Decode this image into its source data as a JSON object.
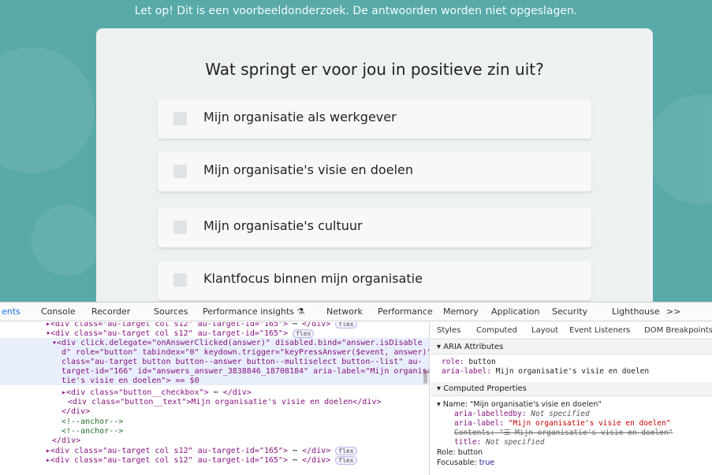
{
  "survey": {
    "banner": "Let op! Dit is een voorbeeldonderzoek. De antwoorden worden niet opgeslagen.",
    "question": "Wat springt er voor jou in positieve zin uit?",
    "answers": [
      "Mijn organisatie als werkgever",
      "Mijn organisatie's visie en doelen",
      "Mijn organisatie's cultuur",
      "Klantfocus binnen mijn organisatie"
    ]
  },
  "devtools": {
    "tabs": [
      "ents",
      "Console",
      "Recorder",
      "Sources",
      "Performance insights ⚗",
      "Network",
      "Performance",
      "Memory",
      "Application",
      "Security",
      "Lighthouse",
      ">>"
    ],
    "active_tab": "ents",
    "elements": {
      "line1_open": "▸<div class=\"au-target col s12\" au-target-id=\"165\">",
      "line1_close": "</div>",
      "line2": "▾<div class=\"au-target col s12\" au-target-id=\"165\">",
      "line3": "▾<div click.delegate=\"onAnswerClicked(answer)\" disabled.bind=\"answer.isDisable",
      "line4": "d\" role=\"button\" tabindex=\"0\" keydown.trigger=\"keyPressAnswer($event, answer)\"",
      "line5": "class=\"au-target button button--answer button--multiselect button--list\" au-",
      "line6": "target-id=\"166\" id=\"answers_answer_3838846_18708184\" aria-label=\"Mijn organisa",
      "line7": "tie's visie en doelen\"> == $0",
      "line8": "▸<div class=\"button__checkbox\"> ",
      "line8_close": "</div>",
      "line9": "<div class=\"button__text\">Mijn organisatie's visie en doelen</div>",
      "line10": "</div>",
      "line11": "<!--anchor-->",
      "line12": "<!--anchor-->",
      "line13": "</div>",
      "line14": "▸<div class=\"au-target col s12\" au-target-id=\"165\">",
      "line15": "▸<div class=\"au-target col s12\" au-target-id=\"165\">",
      "badge": "flex",
      "ellipsis": "⋯"
    },
    "sidebar_tabs": [
      "Styles",
      "Computed",
      "Layout",
      "Event Listeners",
      "DOM Breakpoints"
    ],
    "aria": {
      "header": "▾ ARIA Attributes",
      "role_key": "role:",
      "role_val": "button",
      "label_key": "aria-label:",
      "label_val": "Mijn organisatie's visie en doelen"
    },
    "computed": {
      "header": "▾ Computed Properties",
      "name_line": "▾ Name: \"Mijn organisatie's visie en doelen\"",
      "labelledby_key": "aria-labelledby:",
      "labelledby_val": "Not specified",
      "arialabel_key": "aria-label:",
      "arialabel_val": "\"Mijn organisatie's visie en doelen\"",
      "contents": "Contents: \"☰ Mijn organisatie's visie en doelen\"",
      "title_key": "title:",
      "title_val": "Not specified",
      "role_line": "Role: button",
      "focusable_key": "Focusable:",
      "focusable_val": "true"
    }
  }
}
